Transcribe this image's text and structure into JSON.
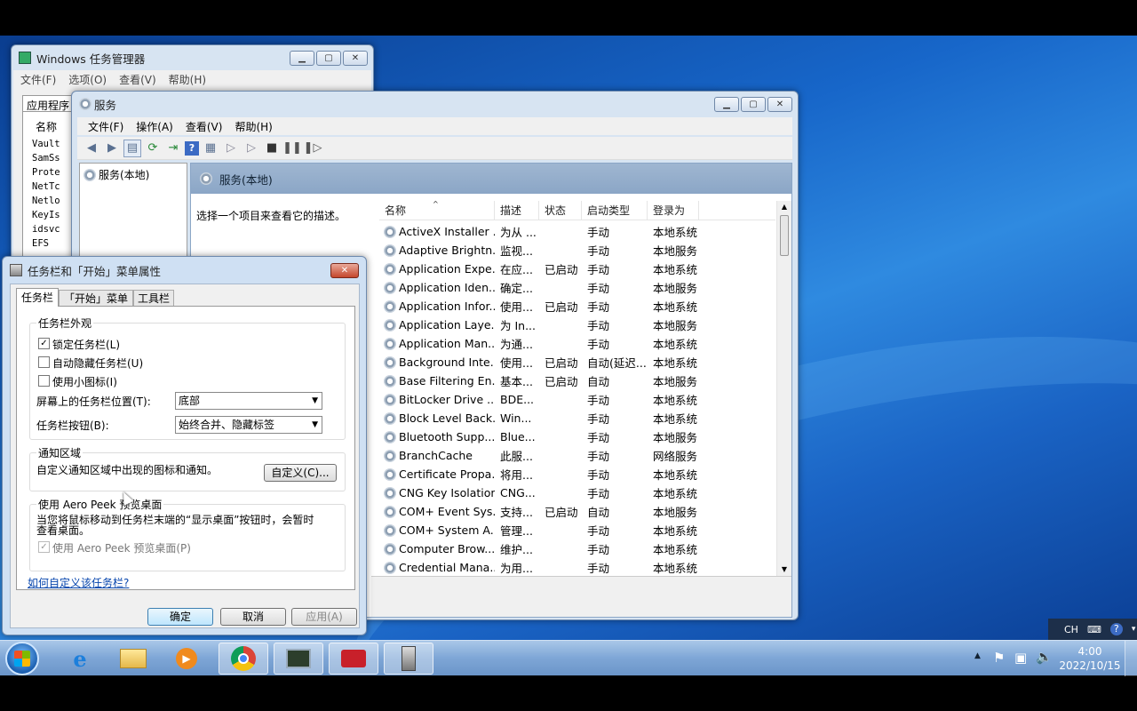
{
  "taskmgr": {
    "title": "Windows 任务管理器",
    "menu": [
      "文件(F)",
      "选项(O)",
      "查看(V)",
      "帮助(H)"
    ],
    "tab": "应用程序",
    "col": "名称",
    "rows": [
      "Vault",
      "SamSs",
      "Prote",
      "NetTc",
      "Netlo",
      "KeyIs",
      "idsvc",
      "EFS"
    ]
  },
  "services": {
    "title": "服务",
    "menu": [
      "文件(F)",
      "操作(A)",
      "查看(V)",
      "帮助(H)"
    ],
    "tree_item": "服务(本地)",
    "pane_title": "服务(本地)",
    "desc_hint": "选择一个项目来查看它的描述。",
    "columns": [
      "名称",
      "描述",
      "状态",
      "启动类型",
      "登录为"
    ],
    "rows": [
      [
        "ActiveX Installer ...",
        "为从 ...",
        "",
        "手动",
        "本地系统"
      ],
      [
        "Adaptive Brightn...",
        "监视...",
        "",
        "手动",
        "本地服务"
      ],
      [
        "Application Expe...",
        "在应...",
        "已启动",
        "手动",
        "本地系统"
      ],
      [
        "Application Iden...",
        "确定...",
        "",
        "手动",
        "本地服务"
      ],
      [
        "Application Infor...",
        "使用...",
        "已启动",
        "手动",
        "本地系统"
      ],
      [
        "Application Laye...",
        "为 In...",
        "",
        "手动",
        "本地服务"
      ],
      [
        "Application Man...",
        "为通...",
        "",
        "手动",
        "本地系统"
      ],
      [
        "Background Inte...",
        "使用...",
        "已启动",
        "自动(延迟...",
        "本地系统"
      ],
      [
        "Base Filtering En...",
        "基本...",
        "已启动",
        "自动",
        "本地服务"
      ],
      [
        "BitLocker Drive ...",
        "BDE...",
        "",
        "手动",
        "本地系统"
      ],
      [
        "Block Level Back...",
        "Win...",
        "",
        "手动",
        "本地系统"
      ],
      [
        "Bluetooth Supp...",
        "Blue...",
        "",
        "手动",
        "本地服务"
      ],
      [
        "BranchCache",
        "此服...",
        "",
        "手动",
        "网络服务"
      ],
      [
        "Certificate Propa...",
        "将用...",
        "",
        "手动",
        "本地系统"
      ],
      [
        "CNG Key Isolation",
        "CNG...",
        "",
        "手动",
        "本地系统"
      ],
      [
        "COM+ Event Sys...",
        "支持...",
        "已启动",
        "自动",
        "本地服务"
      ],
      [
        "COM+ System A...",
        "管理...",
        "",
        "手动",
        "本地系统"
      ],
      [
        "Computer Brow...",
        "维护...",
        "",
        "手动",
        "本地系统"
      ],
      [
        "Credential Mana...",
        "为用...",
        "",
        "手动",
        "本地系统"
      ]
    ]
  },
  "dialog": {
    "title": "任务栏和「开始」菜单属性",
    "tabs": [
      "任务栏",
      "「开始」菜单",
      "工具栏"
    ],
    "appearance_group": "任务栏外观",
    "lock": "锁定任务栏(L)",
    "autohide": "自动隐藏任务栏(U)",
    "small_icons": "使用小图标(I)",
    "position_label": "屏幕上的任务栏位置(T):",
    "position_value": "底部",
    "buttons_label": "任务栏按钮(B):",
    "buttons_value": "始终合并、隐藏标签",
    "notify_group": "通知区域",
    "notify_text": "自定义通知区域中出现的图标和通知。",
    "customize": "自定义(C)...",
    "aero_group": "使用 Aero Peek 预览桌面",
    "aero_text1": "当您将鼠标移动到任务栏末端的“显示桌面”按钮时，会暂时",
    "aero_text2": "查看桌面。",
    "aero_check": "使用 Aero Peek 预览桌面(P)",
    "link": "如何自定义该任务栏?",
    "ok": "确定",
    "cancel": "取消",
    "apply": "应用(A)"
  },
  "tray": {
    "lang": "CH",
    "time": "4:00",
    "date": "2022/10/15"
  }
}
